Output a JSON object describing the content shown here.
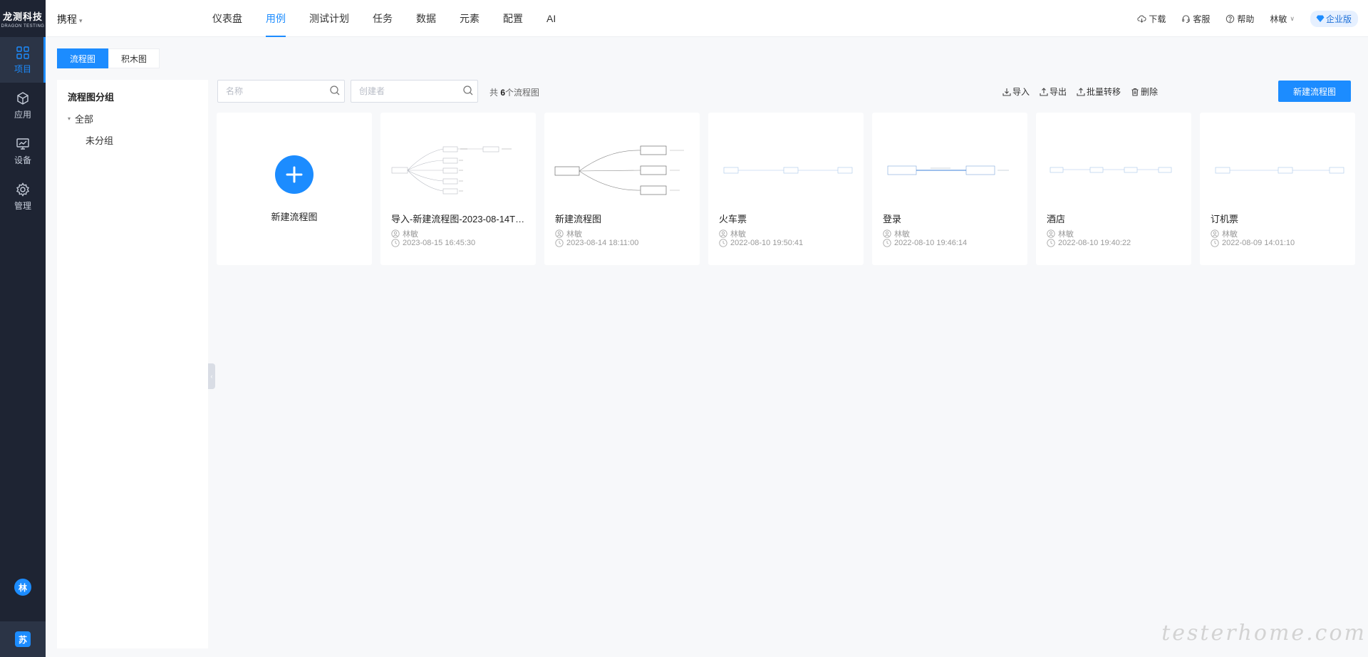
{
  "brand": {
    "name": "龙测科技",
    "subtitle": "DRAGON TESTING"
  },
  "rail": {
    "items": [
      {
        "label": "项目",
        "icon": "grid-icon",
        "active": true
      },
      {
        "label": "应用",
        "icon": "cube-icon",
        "active": false
      },
      {
        "label": "设备",
        "icon": "monitor-icon",
        "active": false
      },
      {
        "label": "管理",
        "icon": "gear-icon",
        "active": false
      }
    ],
    "avatar_initial": "林",
    "team_initial": "苏"
  },
  "topbar": {
    "project": "携程",
    "nav": [
      "仪表盘",
      "用例",
      "测试计划",
      "任务",
      "数据",
      "元素",
      "配置",
      "AI"
    ],
    "active_nav": "用例",
    "download": "下载",
    "service": "客服",
    "help": "帮助",
    "user": "林敏",
    "edition": "企业版"
  },
  "subtabs": [
    "流程图",
    "积木图"
  ],
  "groups": {
    "title": "流程图分组",
    "all": "全部",
    "ungrouped": "未分组"
  },
  "toolbar": {
    "name_placeholder": "名称",
    "creator_placeholder": "创建者",
    "count_prefix": "共 ",
    "count": "6",
    "count_suffix": "个流程图",
    "import": "导入",
    "export": "导出",
    "batch_move": "批量转移",
    "delete": "删除",
    "new_button": "新建流程图"
  },
  "new_card_label": "新建流程图",
  "cards": [
    {
      "name": "导入-新建流程图-2023-08-14T20:...",
      "creator": "林敏",
      "time": "2023-08-15 16:45:30"
    },
    {
      "name": "新建流程图",
      "creator": "林敏",
      "time": "2023-08-14 18:11:00"
    },
    {
      "name": "火车票",
      "creator": "林敏",
      "time": "2022-08-10 19:50:41"
    },
    {
      "name": "登录",
      "creator": "林敏",
      "time": "2022-08-10 19:46:14"
    },
    {
      "name": "酒店",
      "creator": "林敏",
      "time": "2022-08-10 19:40:22"
    },
    {
      "name": "订机票",
      "creator": "林敏",
      "time": "2022-08-09 14:01:10"
    }
  ],
  "watermark": "testerhome.com",
  "colors": {
    "accent": "#1c8cff",
    "rail_bg": "#1e2433",
    "page_bg": "#f7f8fa"
  }
}
